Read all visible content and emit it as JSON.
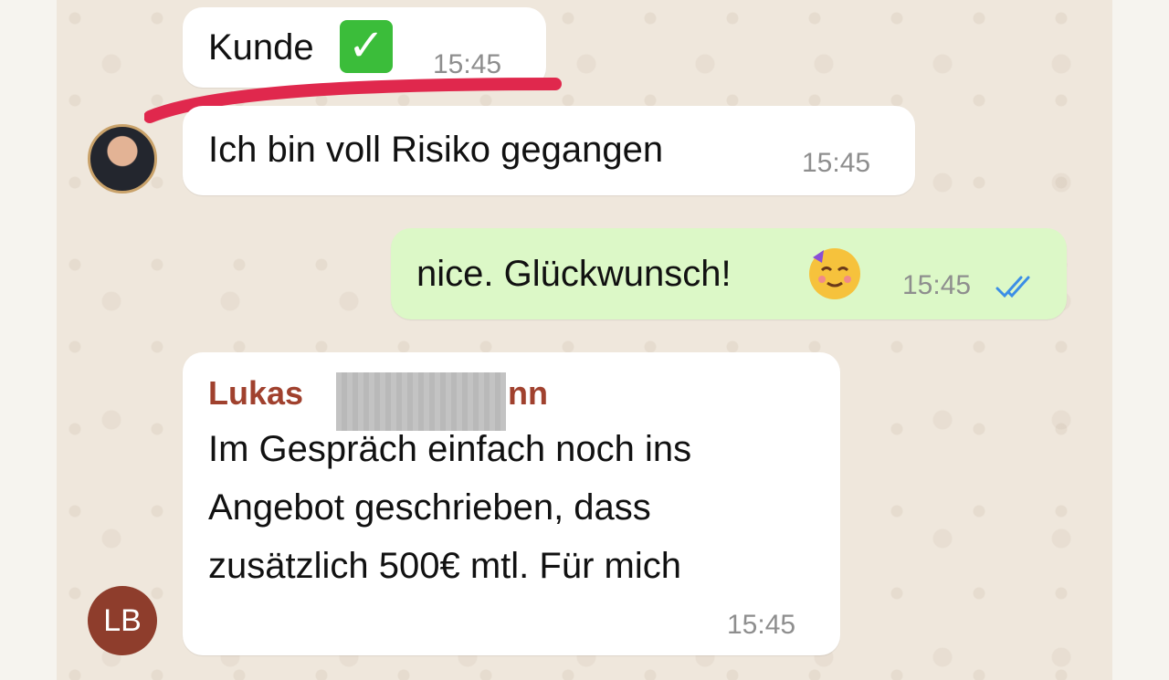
{
  "messages": {
    "m1": {
      "text": "Kunde",
      "emoji": "✓",
      "time": "15:45"
    },
    "m2": {
      "text": "Ich bin voll Risiko gegangen",
      "time": "15:45"
    },
    "m3": {
      "text": "nice. Glückwunsch!",
      "emoji": "party-face",
      "time": "15:45",
      "status": "read"
    },
    "m4": {
      "sender_visible": "Lukas",
      "sender_suffix": "nn",
      "lines": [
        "Im Gespräch einfach noch ins",
        "Angebot geschrieben, dass",
        "zusätzlich 500€ mtl. Für mich"
      ],
      "time": "15:45"
    }
  },
  "avatars": {
    "lb_initials": "LB"
  },
  "colors": {
    "outgoing_bubble": "#dcf8c7",
    "incoming_bubble": "#ffffff",
    "sender_name": "#a0412e",
    "read_ticks": "#3b8ee6",
    "highlight_underline": "#e0284d"
  }
}
